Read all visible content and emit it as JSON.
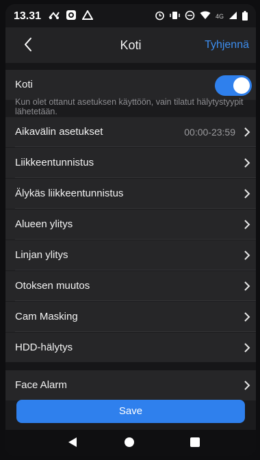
{
  "status_bar": {
    "time": "13.31",
    "network": "4G",
    "icons_left": [
      "bluetooth-icon",
      "camera-icon",
      "drive-icon"
    ],
    "icons_right": [
      "alarm-icon",
      "vibrate-icon",
      "dnd-icon",
      "wifi-icon",
      "signal-icon",
      "battery-icon"
    ]
  },
  "header": {
    "title": "Koti",
    "clear_label": "Tyhjennä",
    "back_icon": "chevron-left-icon"
  },
  "toggle_row": {
    "label": "Koti",
    "enabled": true
  },
  "hint_text": "Kun olet ottanut asetuksen käyttöön, vain tilatut hälytystyypit lähetetään.",
  "settings": [
    {
      "label": "Aikavälin asetukset",
      "value": "00:00-23:59"
    },
    {
      "label": "Liikkeentunnistus",
      "value": ""
    },
    {
      "label": "Älykäs liikkeentunnistus",
      "value": ""
    },
    {
      "label": "Alueen ylitys",
      "value": ""
    },
    {
      "label": "Linjan ylitys",
      "value": ""
    },
    {
      "label": "Otoksen muutos",
      "value": ""
    },
    {
      "label": "Cam Masking",
      "value": ""
    },
    {
      "label": "HDD-hälytys",
      "value": ""
    }
  ],
  "face_alarm": {
    "label": "Face Alarm"
  },
  "save_label": "Save",
  "colors": {
    "accent": "#2f80ed",
    "link": "#3d8ef0",
    "background": "#1b1b1d",
    "row": "#262628"
  }
}
